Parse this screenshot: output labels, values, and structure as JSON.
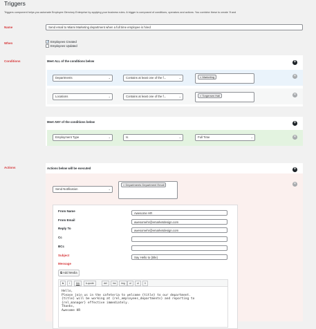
{
  "page": {
    "title": "Triggers",
    "description": "Triggers component helps you automate Employee Directory Enterprise by applying your business rules. A trigger is composed of conditions, operators and actions. You combine these to create 'If and"
  },
  "name_field": {
    "label": "Name",
    "value": "Send email to Miami Marketing department when a full time employee is hired"
  },
  "when": {
    "label": "When",
    "options": [
      {
        "label": "Employees Created",
        "checked": true
      },
      {
        "label": "Employees Updated",
        "checked": false
      }
    ]
  },
  "conditions": {
    "label": "Conditions",
    "all_group": {
      "heading": "Meet ALL of the conditions below",
      "rows": [
        {
          "field": "Departments",
          "operator": "Contains at least one of the f...",
          "value_tag": "Marketing",
          "remove": "✕"
        },
        {
          "field": "Locations",
          "operator": "Contains at least one of the f...",
          "value_tag": "Torgersen Hall",
          "remove": "✕"
        }
      ]
    },
    "any_group": {
      "heading": "Meet ANY of the conditions below",
      "rows": [
        {
          "field": "Employment Type",
          "operator": "Is",
          "value": "Full Time",
          "remove": "✕"
        }
      ]
    }
  },
  "actions": {
    "label": "Actions",
    "heading": "Actions below will be executed",
    "action_type": "Send Notification",
    "recipient_tag": "Departments Department Email",
    "form": {
      "from_name": {
        "label": "From Name",
        "value": "Awesome HR"
      },
      "from_email": {
        "label": "From Email",
        "value": "awesomehr@emarketdesign.com"
      },
      "reply_to": {
        "label": "Reply To",
        "value": "awesomehr@emarketdesign.com"
      },
      "cc": {
        "label": "Cc",
        "value": ""
      },
      "bcc": {
        "label": "BCc",
        "value": ""
      },
      "subject": {
        "label": "Subject",
        "value": "Say Hello to {title}"
      },
      "message_label": "Message",
      "add_media": "Add Media",
      "toolbar": [
        "b",
        "i",
        "link",
        "b-quote",
        "del",
        "ins",
        "img",
        "ul",
        "ol",
        "li"
      ],
      "message": "Hello,\nPlease join us in the cafeteria to welcome {title} to our department.\n{title} will be working at {rel_employees_departments} and reporting to\n{rel_manager} effective immediately.\nThanks,\nAwesome HR"
    }
  },
  "icons": {
    "add": "plus-circle-icon",
    "remove": "remove-circle-icon",
    "chevron": "chevron-down-icon",
    "media": "media-icon"
  },
  "colors": {
    "required_label": "#d63638",
    "all_row_bg": "#eaf3fb",
    "any_row_bg": "#e3f3e0",
    "action_bg": "#fbf0ee"
  }
}
